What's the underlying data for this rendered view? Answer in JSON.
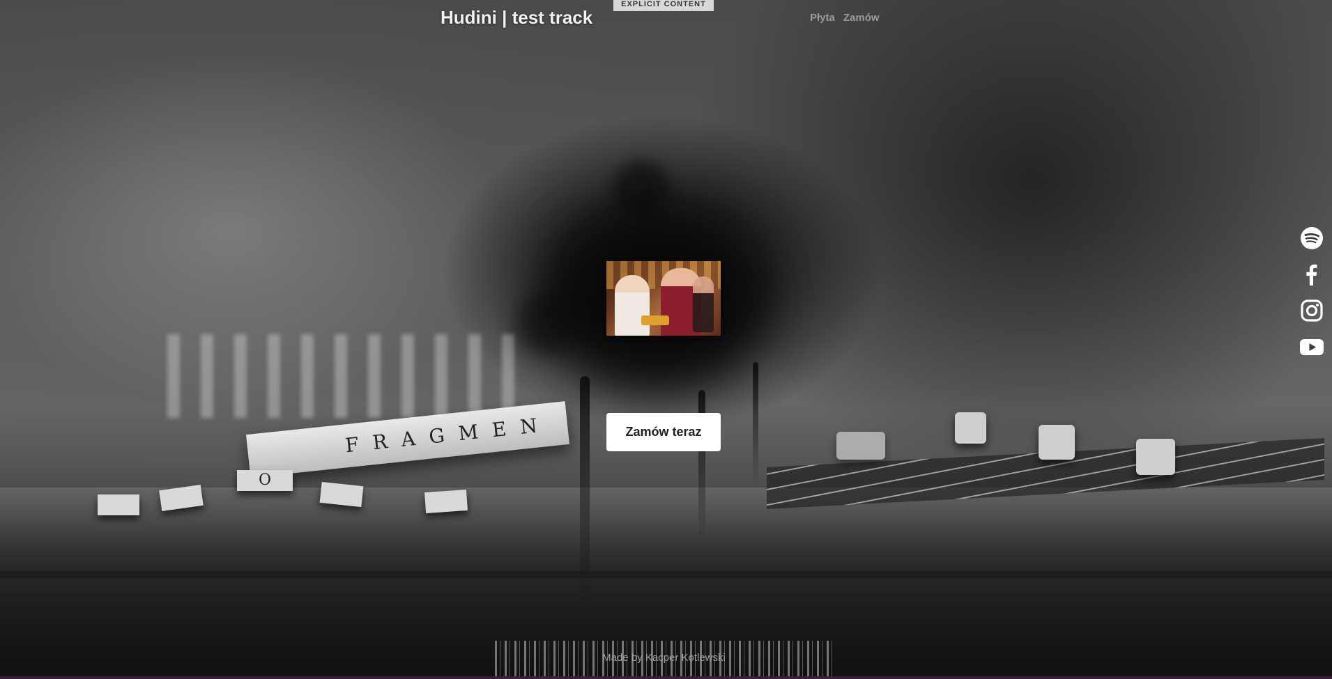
{
  "header": {
    "title": "Hudini | test track",
    "badge": "EXPLICIT CONTENT",
    "nav": [
      "Płyta",
      "Zamów"
    ]
  },
  "main": {
    "cta_label": "Zamów teraz",
    "scene_word": "FRAGMEN",
    "scene_letter": "O"
  },
  "socials": [
    {
      "name": "spotify-icon"
    },
    {
      "name": "facebook-icon"
    },
    {
      "name": "instagram-icon"
    },
    {
      "name": "youtube-icon"
    }
  ],
  "footer": {
    "credit": "Made by Kacper Kotlewski"
  },
  "colors": {
    "button_bg": "#ffffff",
    "title": "#f2f2f2",
    "nav": "#9a9a9a",
    "footer": "#a0a0a0"
  }
}
